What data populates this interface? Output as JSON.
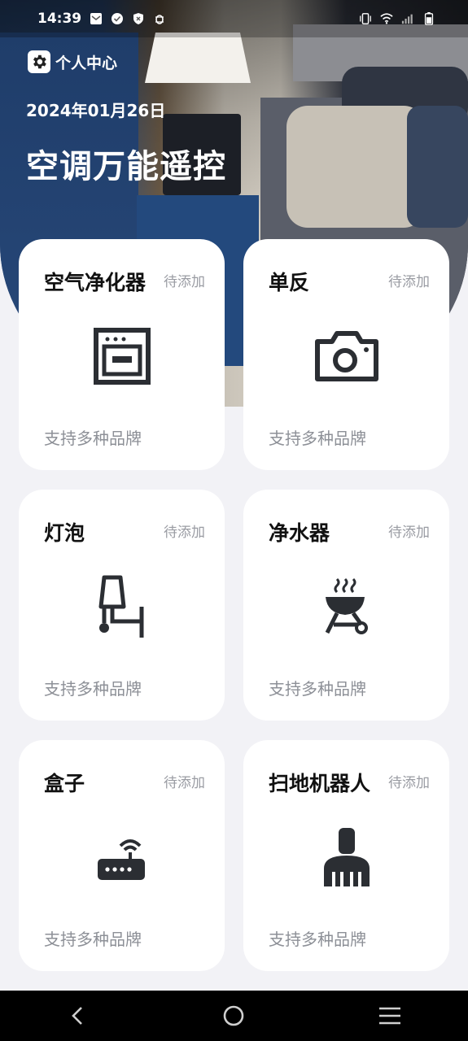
{
  "status_bar": {
    "time": "14:39",
    "left_icons": [
      "mail-icon",
      "check-circle-icon",
      "shield-icon",
      "bug-icon"
    ],
    "right_icons": [
      "vibrate-icon",
      "wifi-icon",
      "signal-icon",
      "battery-icon"
    ]
  },
  "header": {
    "profile_label": "个人中心",
    "date": "2024年01月26日",
    "title": "空调万能遥控"
  },
  "devices": [
    {
      "name": "空气净化器",
      "status": "待添加",
      "icon": "oven-icon",
      "desc": "支持多种品牌"
    },
    {
      "name": "单反",
      "status": "待添加",
      "icon": "camera-icon",
      "desc": "支持多种品牌"
    },
    {
      "name": "灯泡",
      "status": "待添加",
      "icon": "lamp-chair-icon",
      "desc": "支持多种品牌"
    },
    {
      "name": "净水器",
      "status": "待添加",
      "icon": "grill-icon",
      "desc": "支持多种品牌"
    },
    {
      "name": "盒子",
      "status": "待添加",
      "icon": "router-icon",
      "desc": "支持多种品牌"
    },
    {
      "name": "扫地机器人",
      "status": "待添加",
      "icon": "broom-icon",
      "desc": "支持多种品牌"
    }
  ],
  "nav": {
    "back": "back-icon",
    "home": "home-icon",
    "menu": "menu-icon"
  },
  "colors": {
    "background": "#f2f2f6",
    "card": "#ffffff",
    "icon": "#2b2e33",
    "muted": "#9a9ca3"
  }
}
